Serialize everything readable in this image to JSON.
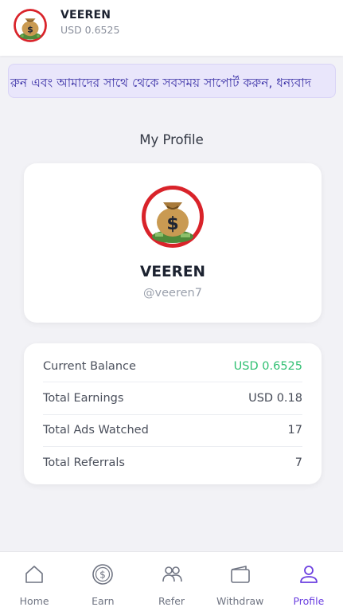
{
  "header": {
    "name": "VEEREN",
    "balance": "USD 0.6525"
  },
  "notice": {
    "text": "রুন এবং আমাদের সাথে থেকে সবসময় সাপোর্ট করুন, ধন্যবাদ"
  },
  "profile": {
    "section_title": "My Profile",
    "name": "VEEREN",
    "handle": "@veeren7"
  },
  "stats": [
    {
      "label": "Current Balance",
      "value": "USD 0.6525"
    },
    {
      "label": "Total Earnings",
      "value": "USD 0.18"
    },
    {
      "label": "Total Ads Watched",
      "value": "17"
    },
    {
      "label": "Total Referrals",
      "value": "7"
    }
  ],
  "nav": {
    "items": [
      {
        "label": "Home",
        "icon": "home-icon"
      },
      {
        "label": "Earn",
        "icon": "dollar-coin-icon"
      },
      {
        "label": "Refer",
        "icon": "users-icon"
      },
      {
        "label": "Withdraw",
        "icon": "wallet-icon"
      },
      {
        "label": "Profile",
        "icon": "user-icon"
      }
    ],
    "active": "Profile"
  },
  "colors": {
    "accent": "#6b3fe0",
    "positive": "#2fbf71",
    "notice_bg": "#e9e6fb",
    "notice_text": "#3d33a8"
  }
}
